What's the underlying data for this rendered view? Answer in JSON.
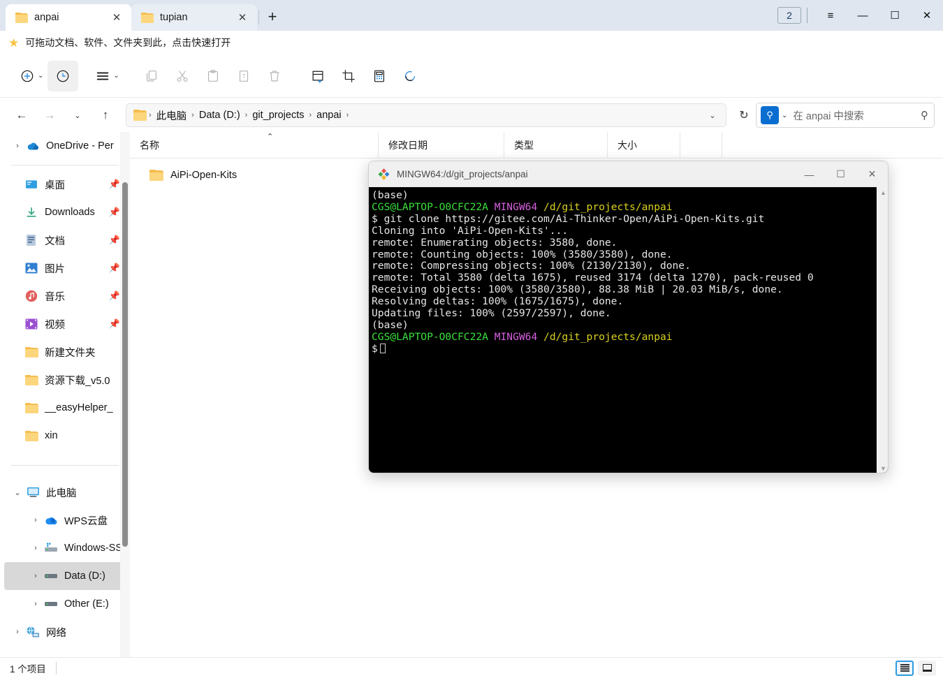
{
  "window": {
    "tabs": [
      {
        "label": "anpai",
        "icon": "folder-icon",
        "active": true,
        "close": "✕"
      },
      {
        "label": "tupian",
        "icon": "folder-icon",
        "active": false,
        "close": "✕"
      }
    ],
    "new_tab_label": "+",
    "tab_count_badge": "2",
    "controls": {
      "menu": "≡",
      "minimize": "—",
      "maximize": "☐",
      "close": "✕"
    }
  },
  "drag_hint": {
    "icon": "star-icon",
    "text": "可拖动文档、软件、文件夹到此，点击快速打开"
  },
  "toolbar": {
    "items": [
      {
        "name": "new-item-button",
        "glyph": "plus-circle-icon",
        "caret": "⌄",
        "state": "normal"
      },
      {
        "name": "history-button",
        "glyph": "clock-icon",
        "caret": "",
        "state": "selected"
      },
      {
        "name": "sort-view-button",
        "glyph": "list-lines-icon",
        "caret": "⌄",
        "state": "normal"
      },
      {
        "name": "copy-button",
        "glyph": "copy-icon",
        "caret": "",
        "state": "disabled"
      },
      {
        "name": "cut-button",
        "glyph": "scissors-icon",
        "caret": "",
        "state": "disabled"
      },
      {
        "name": "paste-button",
        "glyph": "paste-icon",
        "caret": "",
        "state": "disabled"
      },
      {
        "name": "rename-button",
        "glyph": "rename-icon",
        "caret": "",
        "state": "disabled"
      },
      {
        "name": "delete-button",
        "glyph": "trash-icon",
        "caret": "",
        "state": "disabled"
      },
      {
        "name": "new-note-button",
        "glyph": "note-plus-icon",
        "caret": "",
        "state": "normal"
      },
      {
        "name": "screenshot-button",
        "glyph": "crop-icon",
        "caret": "",
        "state": "normal"
      },
      {
        "name": "calculator-button",
        "glyph": "calculator-icon",
        "caret": "",
        "state": "normal"
      },
      {
        "name": "sync-button",
        "glyph": "sync-icon",
        "caret": "",
        "state": "normal"
      }
    ]
  },
  "address": {
    "back": "←",
    "forward": "→",
    "recent": "⌄",
    "up": "↑",
    "crumbs": [
      "此电脑",
      "Data (D:)",
      "git_projects",
      "anpai"
    ],
    "separator": "›",
    "dropdown": "⌄",
    "refresh": "↻"
  },
  "search": {
    "chip_icon": "search-icon",
    "chip_caret": "⌄",
    "placeholder": "在 anpai 中搜索",
    "magnifier": "⚲"
  },
  "sidebar": {
    "items": [
      {
        "label": "OneDrive - Per",
        "icon": "onedrive-cloud-icon",
        "expander": "›",
        "indent": 1,
        "pinned": false,
        "selected": false
      },
      {
        "divider": true
      },
      {
        "label": "桌面",
        "icon": "desktop-icon",
        "expander": "",
        "indent": 2,
        "pinned": true,
        "selected": false
      },
      {
        "label": "Downloads",
        "icon": "download-icon",
        "expander": "",
        "indent": 2,
        "pinned": true,
        "selected": false
      },
      {
        "label": "文档",
        "icon": "documents-icon",
        "expander": "",
        "indent": 2,
        "pinned": true,
        "selected": false
      },
      {
        "label": "图片",
        "icon": "pictures-icon",
        "expander": "",
        "indent": 2,
        "pinned": true,
        "selected": false
      },
      {
        "label": "音乐",
        "icon": "music-icon",
        "expander": "",
        "indent": 2,
        "pinned": true,
        "selected": false
      },
      {
        "label": "视频",
        "icon": "videos-icon",
        "expander": "",
        "indent": 2,
        "pinned": true,
        "selected": false
      },
      {
        "label": "新建文件夹",
        "icon": "folder-icon",
        "expander": "",
        "indent": 2,
        "pinned": false,
        "selected": false
      },
      {
        "label": "资源下载_v5.0",
        "icon": "folder-icon",
        "expander": "",
        "indent": 2,
        "pinned": false,
        "selected": false
      },
      {
        "label": "__easyHelper_",
        "icon": "folder-icon",
        "expander": "",
        "indent": 2,
        "pinned": false,
        "selected": false
      },
      {
        "label": "xin",
        "icon": "folder-icon",
        "expander": "",
        "indent": 2,
        "pinned": false,
        "selected": false
      },
      {
        "divider": true
      },
      {
        "label": "此电脑",
        "icon": "this-pc-icon",
        "expander": "⌄",
        "indent": 1,
        "pinned": false,
        "selected": false
      },
      {
        "label": "WPS云盘",
        "icon": "wps-cloud-icon",
        "expander": "›",
        "indent": 3,
        "pinned": false,
        "selected": false
      },
      {
        "label": "Windows-SSD",
        "icon": "drive-icon",
        "expander": "›",
        "indent": 3,
        "pinned": false,
        "selected": false
      },
      {
        "label": "Data (D:)",
        "icon": "drive-icon",
        "expander": "›",
        "indent": 3,
        "pinned": false,
        "selected": true
      },
      {
        "label": "Other (E:)",
        "icon": "drive-icon",
        "expander": "›",
        "indent": 3,
        "pinned": false,
        "selected": false
      },
      {
        "label": "网络",
        "icon": "network-icon",
        "expander": "›",
        "indent": 1,
        "pinned": false,
        "selected": false
      }
    ]
  },
  "filelist": {
    "columns": [
      {
        "label": "名称",
        "sorted": true,
        "sort_caret": "⌃"
      },
      {
        "label": "修改日期",
        "sorted": false,
        "sort_caret": ""
      },
      {
        "label": "类型",
        "sorted": false,
        "sort_caret": ""
      },
      {
        "label": "大小",
        "sorted": false,
        "sort_caret": ""
      }
    ],
    "rows": [
      {
        "name": "AiPi-Open-Kits",
        "icon": "folder-icon",
        "date": "",
        "type": "",
        "size": ""
      }
    ]
  },
  "terminal": {
    "title": "MINGW64:/d/git_projects/anpai",
    "logo_icon": "git-bash-icon",
    "controls": {
      "minimize": "—",
      "maximize": "☐",
      "close": "✕"
    },
    "scroll_up": "▲",
    "scroll_down": "▼",
    "lines": [
      [
        {
          "t": "(base)",
          "c": "w"
        }
      ],
      [
        {
          "t": "CGS@LAPTOP-O0CFC22A",
          "c": "g"
        },
        {
          "t": " ",
          "c": "w"
        },
        {
          "t": "MINGW64",
          "c": "m"
        },
        {
          "t": " ",
          "c": "w"
        },
        {
          "t": "/d/git_projects/anpai",
          "c": "y"
        }
      ],
      [
        {
          "t": "$ git clone https://gitee.com/Ai-Thinker-Open/AiPi-Open-Kits.git",
          "c": "w"
        }
      ],
      [
        {
          "t": "Cloning into 'AiPi-Open-Kits'...",
          "c": "w"
        }
      ],
      [
        {
          "t": "remote: Enumerating objects: 3580, done.",
          "c": "w"
        }
      ],
      [
        {
          "t": "remote: Counting objects: 100% (3580/3580), done.",
          "c": "w"
        }
      ],
      [
        {
          "t": "remote: Compressing objects: 100% (2130/2130), done.",
          "c": "w"
        }
      ],
      [
        {
          "t": "remote: Total 3580 (delta 1675), reused 3174 (delta 1270), pack-reused 0",
          "c": "w"
        }
      ],
      [
        {
          "t": "Receiving objects: 100% (3580/3580), 88.38 MiB | 20.03 MiB/s, done.",
          "c": "w"
        }
      ],
      [
        {
          "t": "Resolving deltas: 100% (1675/1675), done.",
          "c": "w"
        }
      ],
      [
        {
          "t": "Updating files: 100% (2597/2597), done.",
          "c": "w"
        }
      ],
      [
        {
          "t": "(base)",
          "c": "w"
        }
      ],
      [
        {
          "t": "CGS@LAPTOP-O0CFC22A",
          "c": "g"
        },
        {
          "t": " ",
          "c": "w"
        },
        {
          "t": "MINGW64",
          "c": "m"
        },
        {
          "t": " ",
          "c": "w"
        },
        {
          "t": "/d/git_projects/anpai",
          "c": "y"
        }
      ],
      [
        {
          "t": "$",
          "c": "w"
        },
        {
          "t": "__CURSOR__",
          "c": "w"
        }
      ]
    ]
  },
  "statusbar": {
    "item_count": "1 个项目",
    "views": [
      {
        "name": "details-view-button",
        "icon": "list-view-icon",
        "active": true
      },
      {
        "name": "large-icons-view-button",
        "icon": "tile-view-icon",
        "active": false
      }
    ]
  }
}
